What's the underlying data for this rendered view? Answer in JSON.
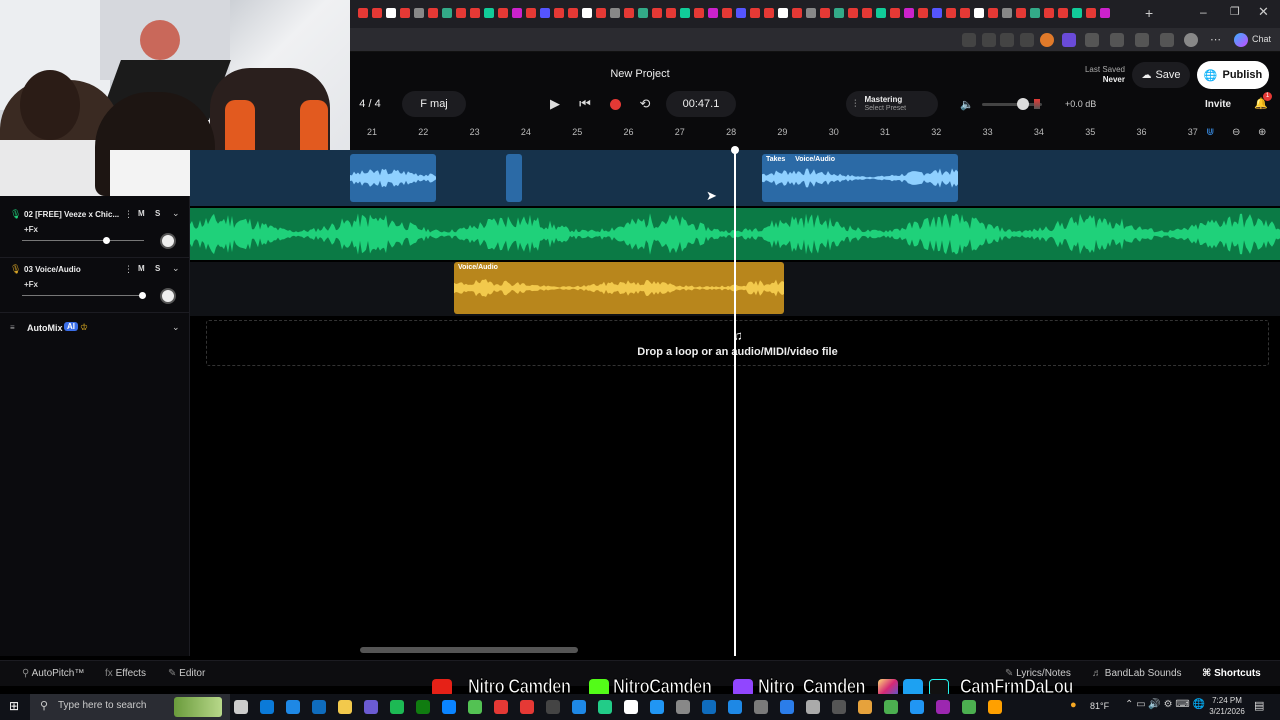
{
  "project": {
    "title": "New Project",
    "time_signature": "4 / 4",
    "key": "F maj",
    "time": "00:47.1",
    "last_saved_label": "Last Saved",
    "last_saved_value": "Never",
    "mastering_label": "Mastering",
    "mastering_preset": "Select Preset",
    "volume_db": "+0.0 dB",
    "save_label": "Save",
    "publish_label": "Publish",
    "invite_label": "Invite",
    "notification_count": "1",
    "chat_label": "Chat"
  },
  "ruler": [
    "21",
    "22",
    "23",
    "24",
    "25",
    "26",
    "27",
    "28",
    "29",
    "30",
    "31",
    "32",
    "33",
    "34",
    "35",
    "36",
    "37"
  ],
  "tracks": [
    {
      "name": "02  [FREE] Veeze x Chic...",
      "fx": "+Fx",
      "mute": "M",
      "solo": "S",
      "volume": 0.7
    },
    {
      "name": "03  Voice/Audio",
      "fx": "+Fx",
      "mute": "M",
      "solo": "S",
      "volume": 0.98
    }
  ],
  "automix": {
    "label": "AutoMix",
    "badge": "AI"
  },
  "clips": {
    "takes_label": "Takes",
    "takes_name": "Voice/Audio",
    "voice_clip_label": "Voice/Audio"
  },
  "drop_text": "Drop a loop or an audio/MIDI/video file",
  "bottom_bar": {
    "autopitch": "AutoPitch™",
    "effects": "Effects",
    "editor": "Editor",
    "lyrics": "Lyrics/Notes",
    "sounds": "BandLab Sounds",
    "shortcuts": "Shortcuts"
  },
  "social": {
    "youtube": "Nitro Camden",
    "kick": "NitroCamden",
    "twitch": "Nitro_Camden",
    "socials": "CamFrmDaLou"
  },
  "taskbar": {
    "search_placeholder": "Type here to search",
    "temperature": "81°F",
    "time": "7:24 PM",
    "date": "3/21/2026"
  },
  "colors": {
    "accent_blue": "#2f6fa8",
    "track_green": "#1fd17a",
    "voice_yellow": "#d8a526",
    "record_red": "#e53935"
  }
}
